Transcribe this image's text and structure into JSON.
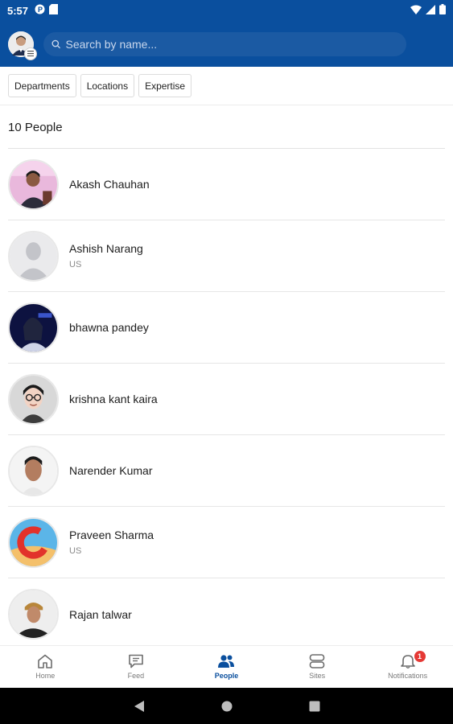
{
  "status_bar": {
    "time": "5:57"
  },
  "search": {
    "placeholder": "Search by name..."
  },
  "filters": [
    "Departments",
    "Locations",
    "Expertise"
  ],
  "people_count": "10 People",
  "people": [
    {
      "name": "Akash Chauhan",
      "location": "",
      "avatar": "photo"
    },
    {
      "name": "Ashish Narang",
      "location": "US",
      "avatar": "placeholder"
    },
    {
      "name": "bhawna pandey",
      "location": "",
      "avatar": "photo"
    },
    {
      "name": "krishna kant kaira",
      "location": "",
      "avatar": "cartoon"
    },
    {
      "name": "Narender Kumar",
      "location": "",
      "avatar": "photo"
    },
    {
      "name": "Praveen Sharma",
      "location": "US",
      "avatar": "logo"
    },
    {
      "name": "Rajan talwar",
      "location": "",
      "avatar": "photo"
    }
  ],
  "bottom_nav": {
    "items": [
      {
        "label": "Home",
        "icon": "home-icon"
      },
      {
        "label": "Feed",
        "icon": "feed-icon"
      },
      {
        "label": "People",
        "icon": "people-icon"
      },
      {
        "label": "Sites",
        "icon": "sites-icon"
      },
      {
        "label": "Notifications",
        "icon": "bell-icon"
      }
    ],
    "active": "People",
    "notification_count": "1"
  },
  "colors": {
    "primary": "#0a4f9e",
    "badge": "#e53935"
  }
}
